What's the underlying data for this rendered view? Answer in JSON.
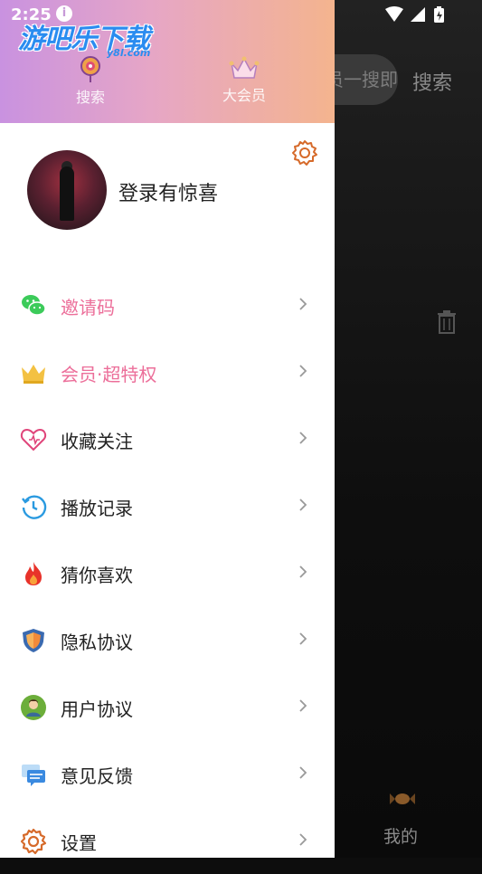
{
  "status_bar": {
    "time": "2:25",
    "info_glyph": "i"
  },
  "background_app": {
    "search_placeholder": "员一搜即",
    "search_button": "搜索",
    "bottom_tab": "我的"
  },
  "drawer": {
    "brand": {
      "name": "游吧乐下载",
      "domain": "y8l.com"
    },
    "header_tabs": [
      {
        "label": "搜索",
        "icon": "lollipop-icon"
      },
      {
        "label": "大会员",
        "icon": "crown-icon"
      }
    ],
    "profile": {
      "login_prompt": "登录有惊喜"
    },
    "menu": [
      {
        "label": "邀请码",
        "icon": "wechat-icon",
        "highlight": true
      },
      {
        "label": "会员·超特权",
        "icon": "gold-crown-icon",
        "highlight": true
      },
      {
        "label": "收藏关注",
        "icon": "heart-icon",
        "highlight": false
      },
      {
        "label": "播放记录",
        "icon": "history-clock-icon",
        "highlight": false
      },
      {
        "label": "猜你喜欢",
        "icon": "fire-icon",
        "highlight": false
      },
      {
        "label": "隐私协议",
        "icon": "shield-icon",
        "highlight": false
      },
      {
        "label": "用户协议",
        "icon": "user-badge-icon",
        "highlight": false
      },
      {
        "label": "意见反馈",
        "icon": "feedback-icon",
        "highlight": false
      },
      {
        "label": "设置",
        "icon": "settings-gear-icon",
        "highlight": false
      }
    ]
  },
  "colors": {
    "accent_pink": "#ec6f9a",
    "header_gradient_start": "#c992e0",
    "header_gradient_end": "#f4b48e"
  }
}
